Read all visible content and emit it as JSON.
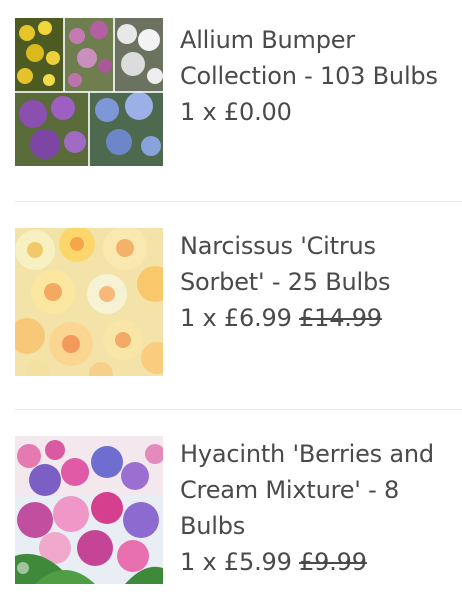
{
  "cart": {
    "items": [
      {
        "title": "Allium Bumper Collection - 103 Bulbs",
        "qty_price": "1 x £0.00",
        "was_price": "",
        "image": "allium-collage-image"
      },
      {
        "title": "Narcissus 'Citrus Sorbet' - 25 Bulbs",
        "qty_price": "1 x £6.99",
        "was_price": "£14.99",
        "image": "narcissus-photo-image"
      },
      {
        "title": "Hyacinth 'Berries and Cream Mixture' - 8 Bulbs",
        "qty_price": "1 x £5.99",
        "was_price": "£9.99",
        "image": "hyacinth-photo-image"
      }
    ]
  },
  "colors": {
    "text": "#4a4a4a",
    "divider": "#e6e6e6",
    "background": "#ffffff"
  }
}
